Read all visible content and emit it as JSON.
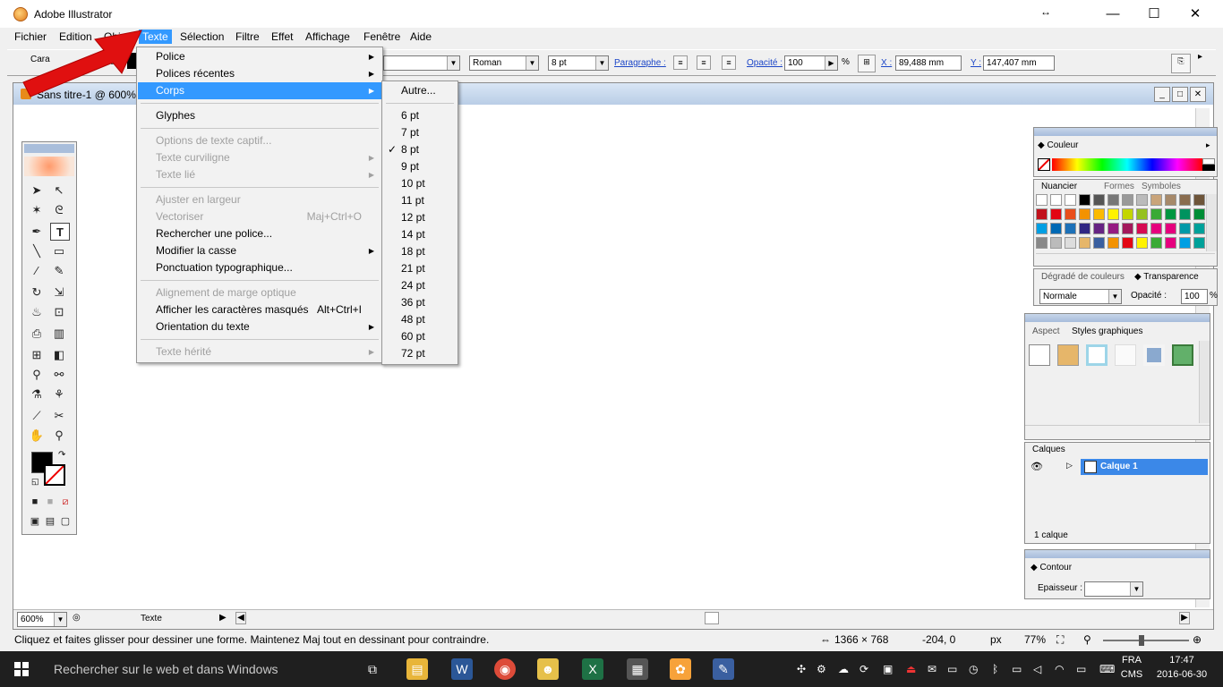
{
  "window": {
    "title": "Adobe Illustrator",
    "controls": {
      "resize": "↔",
      "minimize": "—",
      "maximize": "☐",
      "close": "✕"
    }
  },
  "menubar": {
    "items": [
      "Fichier",
      "Edition",
      "Objet",
      "Texte",
      "Sélection",
      "Filtre",
      "Effet",
      "Affichage",
      "Fenêtre",
      "Aide"
    ],
    "active": "Texte"
  },
  "controlbar": {
    "caractere_label": "Cara",
    "fond_label": "ond :",
    "font_style": "Roman",
    "font_size": "8 pt",
    "paragraphe": "Paragraphe :",
    "opacite_label": "Opacité :",
    "opacite_value": "100",
    "percent": "%",
    "x_label": "X :",
    "x_value": "89,488 mm",
    "y_label": "Y :",
    "y_value": "147,407 mm"
  },
  "document": {
    "title": "Sans titre-1 @ 600% ("
  },
  "texte_menu": [
    {
      "label": "Police",
      "sub": true
    },
    {
      "label": "Polices récentes",
      "sub": true
    },
    {
      "label": "Corps",
      "sub": true,
      "highlighted": true
    },
    {
      "label": "Glyphes"
    },
    {
      "label": "Options de texte captif...",
      "disabled": true
    },
    {
      "label": "Texte curviligne",
      "disabled": true,
      "sub": true
    },
    {
      "label": "Texte lié",
      "disabled": true,
      "sub": true
    },
    {
      "label": "Ajuster en largeur",
      "disabled": true
    },
    {
      "label": "Vectoriser",
      "disabled": true,
      "shortcut": "Maj+Ctrl+O"
    },
    {
      "label": "Rechercher une police..."
    },
    {
      "label": "Modifier la casse",
      "sub": true
    },
    {
      "label": "Ponctuation typographique..."
    },
    {
      "label": "Alignement de marge optique",
      "disabled": true
    },
    {
      "label": "Afficher les caractères masqués",
      "shortcut": "Alt+Ctrl+I"
    },
    {
      "label": "Orientation du texte",
      "sub": true
    },
    {
      "label": "Texte hérité",
      "disabled": true,
      "sub": true
    }
  ],
  "corps_submenu": {
    "other": "Autre...",
    "sizes": [
      "6 pt",
      "7 pt",
      "8 pt",
      "9 pt",
      "10 pt",
      "11 pt",
      "12 pt",
      "14 pt",
      "18 pt",
      "21 pt",
      "24 pt",
      "36 pt",
      "48 pt",
      "60 pt",
      "72 pt"
    ],
    "checked": "8 pt",
    "check_glyph": "✓"
  },
  "panels": {
    "couleur": {
      "tab": "Couleur"
    },
    "nuancier": {
      "tabs": [
        "Nuancier",
        "Formes",
        "Symboles"
      ]
    },
    "degrade": {
      "tabs": [
        "Dégradé de couleurs",
        "Transparence"
      ],
      "mode": "Normale",
      "opacite_label": "Opacité :",
      "opacite_value": "100",
      "percent": "%"
    },
    "aspect": {
      "tabs": [
        "Aspect",
        "Styles graphiques"
      ]
    },
    "calques": {
      "tab": "Calques",
      "layer_name": "Calque 1",
      "count": "1 calque"
    },
    "contour": {
      "tab": "Contour",
      "epaisseur_label": "Epaisseur :"
    }
  },
  "doc_footer": {
    "zoom": "600%",
    "tool_name": "Texte"
  },
  "statusbar": {
    "hint": "Cliquez et faites glisser pour dessiner une forme. Maintenez Maj tout en dessinant pour contraindre.",
    "dimensions": "1366 × 768",
    "coords": "-204, 0",
    "unit": "px",
    "zoom": "77%"
  },
  "taskbar": {
    "search_placeholder": "Rechercher sur le web et dans Windows",
    "lang_top": "FRA",
    "lang_bottom": "CMS",
    "time": "17:47",
    "date": "2016-06-30"
  },
  "colors": {
    "menu_highlight": "#3399ff",
    "arrow_red": "#e01010",
    "layer_highlight": "#3b88e8",
    "taskbar": "#1f1f1f"
  }
}
